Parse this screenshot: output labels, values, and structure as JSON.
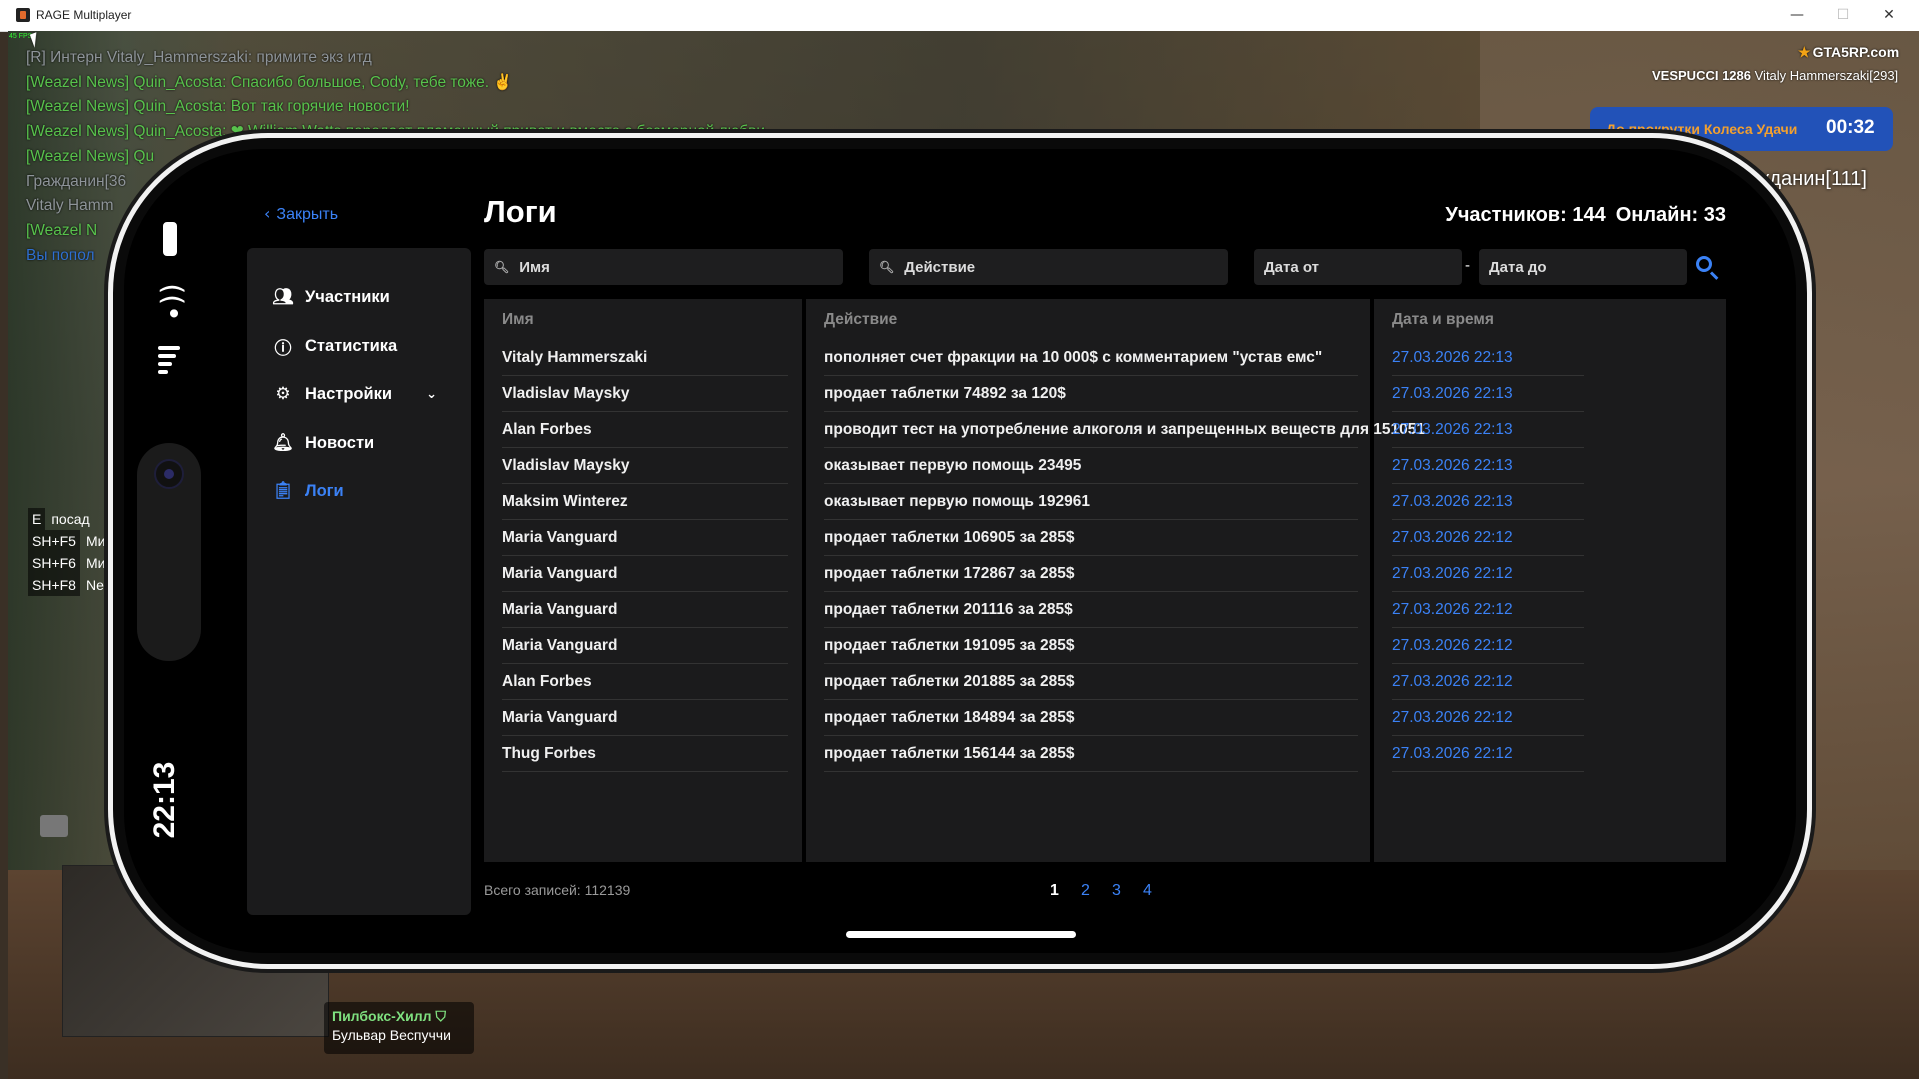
{
  "window": {
    "title": "RAGE Multiplayer",
    "minimize": "—",
    "maximize": "☐",
    "close": "✕"
  },
  "game": {
    "fps": "45 FPS",
    "chat": [
      {
        "text": "[R] Интерн Vitaly_Hammerszaki: примите экз итд",
        "color": "gray"
      },
      {
        "text": "[Weazel News] Quin_Acosta: Спасибо большое, Cody, тебе тоже. ✌",
        "color": "green"
      },
      {
        "text": "[Weazel News] Quin_Acosta: Вот так горячие новости!",
        "color": "green"
      },
      {
        "text": "[Weazel News] Quin_Acosta: ❤ William Watts передает пламенный привет и вместе с безмерной любви",
        "color": "green"
      },
      {
        "text": "[Weazel News] Qu",
        "color": "green"
      },
      {
        "text": "Гражданин[36",
        "color": "gray"
      },
      {
        "text": "Vitaly Hamm",
        "color": "gray"
      },
      {
        "text": "[Weazel N",
        "color": "green"
      },
      {
        "text": "Вы попол",
        "color": "blue"
      }
    ],
    "logo": "GTA5RP.com",
    "server_name": "VESPUCCI 1286",
    "player_name": "Vitaly Hammerszaki[293]",
    "wheel_label": "До прокрутки Колеса Удачи",
    "wheel_timer": "00:32",
    "side_text": "жданин[111]",
    "hotkeys": [
      {
        "key": "E",
        "label": "посад"
      },
      {
        "key": "SH+F5",
        "label": "Ми"
      },
      {
        "key": "SH+F6",
        "label": "Ми"
      },
      {
        "key": "SH+F8",
        "label": "Ne"
      }
    ],
    "location_zone": "Пилбокс-Хилл",
    "location_street": "Бульвар Веспуччи"
  },
  "phone": {
    "clock": "22:13"
  },
  "app": {
    "close_label": "Закрыть",
    "title": "Логи",
    "members_label": "Участников: 144",
    "online_label": "Онлайн: 33",
    "nav": [
      {
        "label": "Участники",
        "icon": "users-icon"
      },
      {
        "label": "Статистика",
        "icon": "info-icon"
      },
      {
        "label": "Настройки",
        "icon": "gear-icon"
      },
      {
        "label": "Новости",
        "icon": "bell-icon"
      },
      {
        "label": "Логи",
        "icon": "clipboard-icon"
      }
    ],
    "filters": {
      "name_placeholder": "Имя",
      "action_placeholder": "Действие",
      "date_from_placeholder": "Дата от",
      "date_to_placeholder": "Дата до",
      "dash": "-"
    },
    "table": {
      "headers": [
        "Имя",
        "Действие",
        "Дата и время"
      ],
      "rows": [
        {
          "name": "Vitaly Hammerszaki",
          "action": "пополняет счет фракции на 10 000$ с комментарием \"устав емс\"",
          "date": "27.03.2026 22:13"
        },
        {
          "name": "Vladislav Maysky",
          "action": "продает таблетки 74892 за 120$",
          "date": "27.03.2026 22:13"
        },
        {
          "name": "Alan Forbes",
          "action": "проводит тест на употребление алкоголя и запрещенных веществ для 151051",
          "date": "27.03.2026 22:13"
        },
        {
          "name": "Vladislav Maysky",
          "action": "оказывает первую помощь 23495",
          "date": "27.03.2026 22:13"
        },
        {
          "name": "Maksim Winterez",
          "action": "оказывает первую помощь 192961",
          "date": "27.03.2026 22:13"
        },
        {
          "name": "Maria Vanguard",
          "action": "продает таблетки 106905 за 285$",
          "date": "27.03.2026 22:12"
        },
        {
          "name": "Maria Vanguard",
          "action": "продает таблетки 172867 за 285$",
          "date": "27.03.2026 22:12"
        },
        {
          "name": "Maria Vanguard",
          "action": "продает таблетки 201116 за 285$",
          "date": "27.03.2026 22:12"
        },
        {
          "name": "Maria Vanguard",
          "action": "продает таблетки 191095 за 285$",
          "date": "27.03.2026 22:12"
        },
        {
          "name": "Alan Forbes",
          "action": "продает таблетки 201885 за 285$",
          "date": "27.03.2026 22:12"
        },
        {
          "name": "Maria Vanguard",
          "action": "продает таблетки 184894 за 285$",
          "date": "27.03.2026 22:12"
        },
        {
          "name": "Thug Forbes",
          "action": "продает таблетки 156144 за 285$",
          "date": "27.03.2026 22:12"
        }
      ]
    },
    "total_label": "Всего записей: 112139",
    "pages": [
      "1",
      "2",
      "3",
      "4"
    ],
    "current_page": "1",
    "accent": "#3b82f6"
  }
}
